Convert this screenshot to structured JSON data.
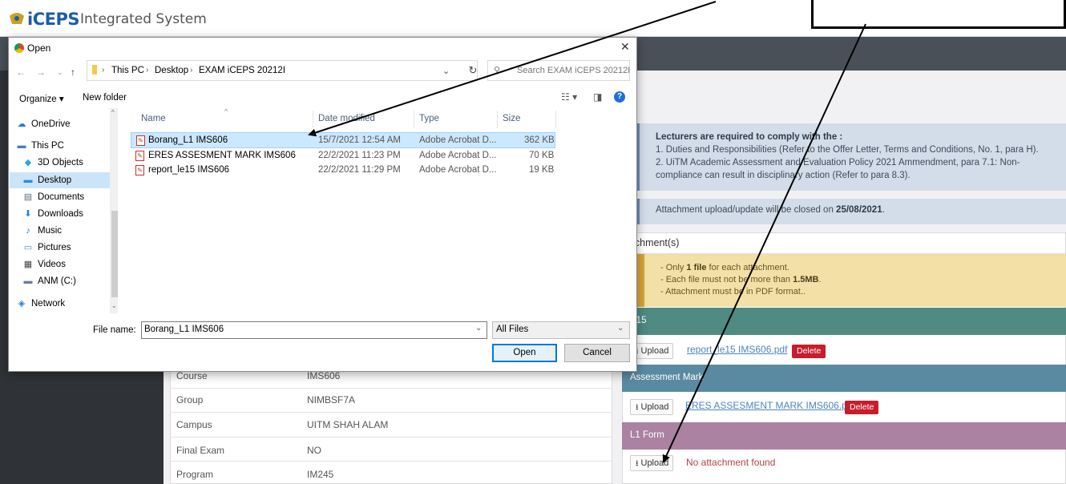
{
  "app": {
    "brand": "iCEPS",
    "title": "Integrated System"
  },
  "topbar_buttons": [
    {
      "icon": "expand-icon",
      "glyph": "⤢"
    },
    {
      "icon": "logout-icon",
      "glyph": "➜"
    },
    {
      "icon": "menu-icon",
      "glyph": "≡"
    }
  ],
  "notice": {
    "heading": "Lecturers are required to comply with the :",
    "line1": "1. Duties and Responsibilities (Refer to the Offer Letter, Terms and Conditions, No. 1, para H).",
    "line2": "2. UiTM Academic Assessment and Evaluation Policy 2021 Ammendment, para 7.1: Non-",
    "line3": "compliance can result in disciplinary action (Refer to para 8.3)."
  },
  "closing": {
    "prefix": "Attachment upload/update will be closed on ",
    "date": "25/08/2021",
    "suffix": "."
  },
  "attachments": {
    "header": "ttachment(s)",
    "rules": {
      "r1_pre": "- Only ",
      "r1_bold": "1 file",
      "r1_post": " for each attachment.",
      "r2_pre": "- Each file must not be more than ",
      "r2_bold": "1.5MB",
      "r2_post": ".",
      "r3": "- Attachment must be in PDF format.."
    },
    "sections": [
      {
        "title": "E15",
        "color": "#4f8a83",
        "file": "report_le15 IMS606.pdf",
        "has_file": true
      },
      {
        "title": "Assessment Mark",
        "color": "#5a8aa2",
        "file": "ERES ASSESMENT MARK IMS606.pdf",
        "has_file": true
      },
      {
        "title": "L1 Form",
        "color": "#ab82a2",
        "file": "",
        "has_file": false
      }
    ],
    "upload_label": "Upload",
    "delete_label": "Delete",
    "no_attachment": "No attachment found"
  },
  "info_rows": [
    {
      "label": "Course",
      "value": "IMS606"
    },
    {
      "label": "Group",
      "value": "NIMBSF7A"
    },
    {
      "label": "Campus",
      "value": "UITM SHAH ALAM"
    },
    {
      "label": "Final Exam",
      "value": "NO"
    },
    {
      "label": "Program",
      "value": "IM245"
    }
  ],
  "dialog": {
    "title": "Open",
    "breadcrumb": [
      "This PC",
      "Desktop",
      "EXAM iCEPS 20212I"
    ],
    "search_placeholder": "Search EXAM iCEPS 20212I",
    "organize": "Organize ▾",
    "new_folder": "New folder",
    "nav": [
      {
        "label": "OneDrive",
        "icon": "onedrive-icon",
        "glyph": "☁",
        "color": "#1e78d2"
      },
      {
        "label": "This PC",
        "icon": "this-pc-icon",
        "glyph": "▬",
        "color": "#3f7fc8"
      },
      {
        "label": "3D Objects",
        "icon": "3d-objects-icon",
        "glyph": "◆",
        "color": "#2aa7dd"
      },
      {
        "label": "Desktop",
        "icon": "desktop-icon",
        "glyph": "▬",
        "color": "#2b8ad6"
      },
      {
        "label": "Documents",
        "icon": "documents-icon",
        "glyph": "▤",
        "color": "#5b6d83"
      },
      {
        "label": "Downloads",
        "icon": "downloads-icon",
        "glyph": "⬇",
        "color": "#2c7ed0"
      },
      {
        "label": "Music",
        "icon": "music-icon",
        "glyph": "♪",
        "color": "#1d6fc4"
      },
      {
        "label": "Pictures",
        "icon": "pictures-icon",
        "glyph": "▭",
        "color": "#3c8ed8"
      },
      {
        "label": "Videos",
        "icon": "videos-icon",
        "glyph": "▦",
        "color": "#444"
      },
      {
        "label": "ANM (C:)",
        "icon": "drive-icon",
        "glyph": "▬",
        "color": "#6a7d92"
      },
      {
        "label": "Network",
        "icon": "network-icon",
        "glyph": "◈",
        "color": "#2b7dd0"
      }
    ],
    "columns": [
      "Name",
      "Date modified",
      "Type",
      "Size"
    ],
    "files": [
      {
        "name": "Borang_L1 IMS606",
        "date": "15/7/2021 12:54 AM",
        "type": "Adobe Acrobat D...",
        "size": "362 KB",
        "selected": true
      },
      {
        "name": "ERES ASSESMENT MARK IMS606",
        "date": "22/2/2021 11:23 PM",
        "type": "Adobe Acrobat D...",
        "size": "70 KB",
        "selected": false
      },
      {
        "name": "report_le15 IMS606",
        "date": "22/2/2021 11:29 PM",
        "type": "Adobe Acrobat D...",
        "size": "19 KB",
        "selected": false
      }
    ],
    "file_name_label": "File name:",
    "file_name_value": "Borang_L1 IMS606",
    "file_type": "All Files",
    "open_label": "Open",
    "cancel_label": "Cancel"
  }
}
